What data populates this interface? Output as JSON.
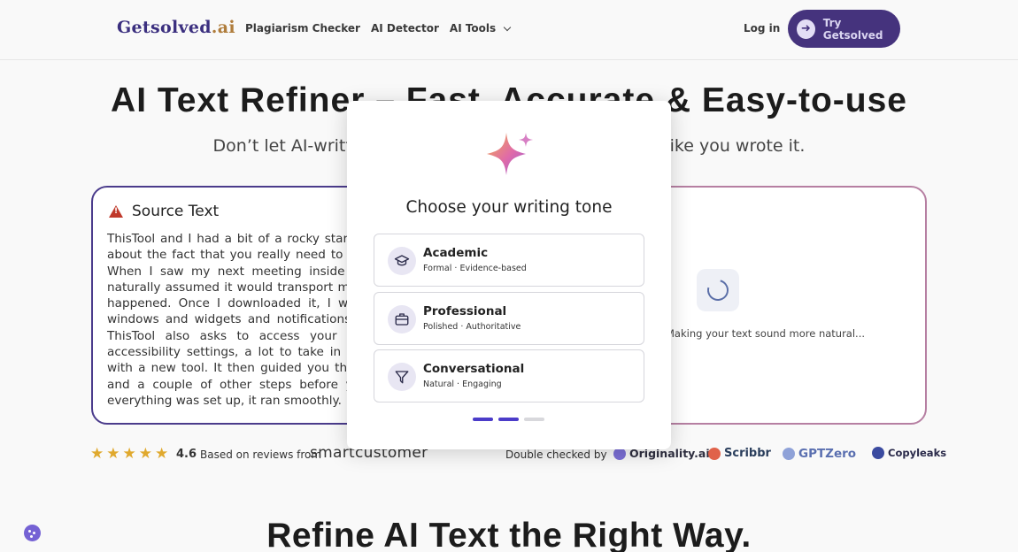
{
  "header": {
    "logo_main": "Getsolved",
    "logo_suffix": ".ai",
    "nav": [
      "Plagiarism Checker",
      "AI Detector",
      "AI Tools"
    ],
    "login": "Log in",
    "cta": "Try Getsolved"
  },
  "hero": {
    "title": "AI Text Refiner – Fast, Accurate & Easy-to-use",
    "subtitle": "Don’t let AI-written text sound robotic. Make it sound like you wrote it."
  },
  "source": {
    "heading": "Source Text",
    "text": "ThisTool and I had a bit of a rocky start. I think there should be clearer about the fact that you really need to download the app for it to work. When I saw my next meeting inside the app had a \"Join\" button, I naturally assumed it would transport me like most tools do. But nothing happened. Once I downloaded it, I was greeted by a bunch of little windows and widgets and notifications which felt a bit overwhelming. ThisTool also asks to access your computer through privacy and accessibility settings, a lot to take in when you're just getting started with a new tool. It then guided you through setting up your audio and and a couple of other steps before you can really get going. Once everything was set up, it ran smoothly."
  },
  "result": {
    "processing": "Making your text sound more natural..."
  },
  "rating": {
    "score": "4.6",
    "based_on": "Based on reviews from",
    "source": "smartcustomer",
    "double_checked": "Double checked by",
    "brands": [
      "Originality.ai",
      "Scribbr",
      "GPTZero",
      "Copyleaks"
    ]
  },
  "bottom": {
    "title": "Refine AI Text the Right Way."
  },
  "modal": {
    "title": "Choose your writing tone",
    "options": [
      {
        "title": "Academic",
        "desc": "Formal · Evidence-based",
        "icon": "graduation-cap-icon"
      },
      {
        "title": "Professional",
        "desc": "Polished · Authoritative",
        "icon": "briefcase-icon"
      },
      {
        "title": "Conversational",
        "desc": "Natural · Engaging",
        "icon": "paper-plane-icon"
      }
    ],
    "step": 2,
    "total_steps": 3
  },
  "colors": {
    "brand": "#45337d",
    "accent": "#4b3cc9",
    "star": "#e0a92e"
  }
}
